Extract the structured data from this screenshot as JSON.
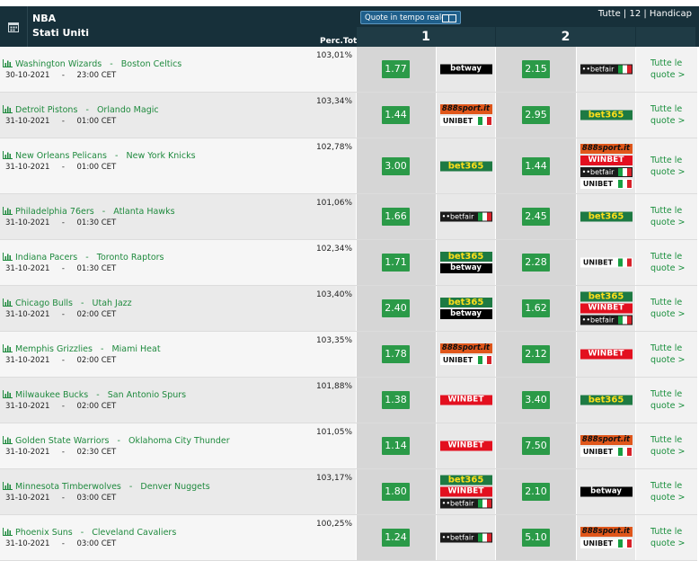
{
  "header": {
    "league": "NBA",
    "country": "Stati Uniti",
    "perc_label": "Perc.Tot",
    "live_label": "Quote in tempo reale",
    "links": "Tutte | 12 | Handicap",
    "col1": "1",
    "col2": "2"
  },
  "more_label_1": "Tutte le",
  "more_label_2": "quote >",
  "brand_colors": {
    "odds_green": "#2b9a48",
    "header": "#17303a",
    "link_green": "#1f8a3e"
  },
  "rows": [
    {
      "home": "Washington Wizards",
      "away": "Boston Celtics",
      "date": "30-10-2021",
      "time": "23:00 CET",
      "perc": "103,01%",
      "odd1": "1.77",
      "odd2": "2.15",
      "books1": [
        "Betway"
      ],
      "books2": [
        "Betfair IT"
      ]
    },
    {
      "home": "Detroit Pistons",
      "away": "Orlando Magic",
      "date": "31-10-2021",
      "time": "01:00 CET",
      "perc": "103,34%",
      "odd1": "1.44",
      "odd2": "2.95",
      "books1": [
        "888sport.it",
        "Unibet IT"
      ],
      "books2": [
        "bet365"
      ]
    },
    {
      "home": "New Orleans Pelicans",
      "away": "New York Knicks",
      "date": "31-10-2021",
      "time": "01:00 CET",
      "perc": "102,78%",
      "odd1": "3.00",
      "odd2": "1.44",
      "books1": [
        "bet365"
      ],
      "books2": [
        "888sport.it",
        "Winbet",
        "Betfair IT",
        "Unibet IT"
      ]
    },
    {
      "home": "Philadelphia 76ers",
      "away": "Atlanta Hawks",
      "date": "31-10-2021",
      "time": "01:30 CET",
      "perc": "101,06%",
      "odd1": "1.66",
      "odd2": "2.45",
      "books1": [
        "Betfair IT"
      ],
      "books2": [
        "bet365"
      ]
    },
    {
      "home": "Indiana Pacers",
      "away": "Toronto Raptors",
      "date": "31-10-2021",
      "time": "01:30 CET",
      "perc": "102,34%",
      "odd1": "1.71",
      "odd2": "2.28",
      "books1": [
        "bet365",
        "Betway"
      ],
      "books2": [
        "Unibet IT"
      ]
    },
    {
      "home": "Chicago Bulls",
      "away": "Utah Jazz",
      "date": "31-10-2021",
      "time": "02:00 CET",
      "perc": "103,40%",
      "odd1": "2.40",
      "odd2": "1.62",
      "books1": [
        "bet365",
        "Betway"
      ],
      "books2": [
        "bet365",
        "Winbet",
        "Betfair IT"
      ]
    },
    {
      "home": "Memphis Grizzlies",
      "away": "Miami Heat",
      "date": "31-10-2021",
      "time": "02:00 CET",
      "perc": "103,35%",
      "odd1": "1.78",
      "odd2": "2.12",
      "books1": [
        "888sport.it",
        "Unibet IT"
      ],
      "books2": [
        "Winbet"
      ]
    },
    {
      "home": "Milwaukee Bucks",
      "away": "San Antonio Spurs",
      "date": "31-10-2021",
      "time": "02:00 CET",
      "perc": "101,88%",
      "odd1": "1.38",
      "odd2": "3.40",
      "books1": [
        "Winbet"
      ],
      "books2": [
        "bet365"
      ]
    },
    {
      "home": "Golden State Warriors",
      "away": "Oklahoma City Thunder",
      "date": "31-10-2021",
      "time": "02:30 CET",
      "perc": "101,05%",
      "odd1": "1.14",
      "odd2": "7.50",
      "books1": [
        "Winbet"
      ],
      "books2": [
        "888sport.it",
        "Unibet IT"
      ]
    },
    {
      "home": "Minnesota Timberwolves",
      "away": "Denver Nuggets",
      "date": "31-10-2021",
      "time": "03:00 CET",
      "perc": "103,17%",
      "odd1": "1.80",
      "odd2": "2.10",
      "books1": [
        "bet365",
        "Winbet",
        "Betfair IT"
      ],
      "books2": [
        "Betway"
      ]
    },
    {
      "home": "Phoenix Suns",
      "away": "Cleveland Cavaliers",
      "date": "31-10-2021",
      "time": "03:00 CET",
      "perc": "100,25%",
      "odd1": "1.24",
      "odd2": "5.10",
      "books1": [
        "Betfair IT"
      ],
      "books2": [
        "888sport.it",
        "Unibet IT"
      ]
    }
  ]
}
